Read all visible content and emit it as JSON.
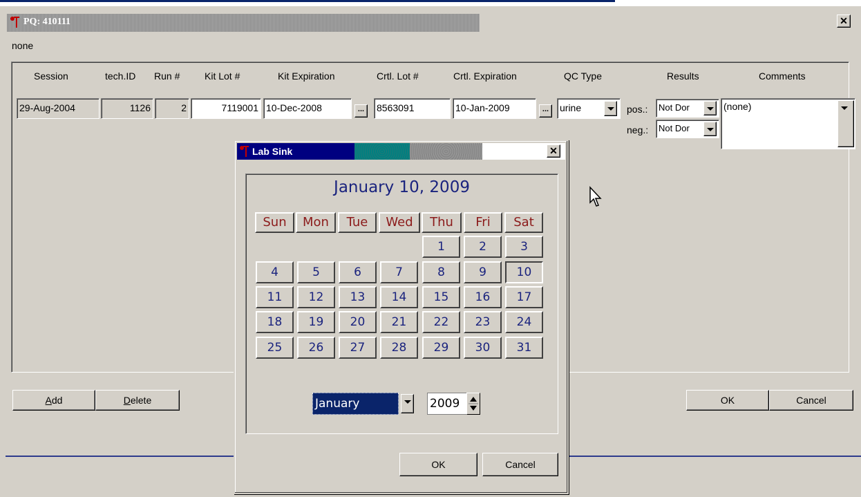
{
  "window": {
    "title": "PQ: 410111",
    "subtitle": "none"
  },
  "grid": {
    "headers": [
      "Session",
      "tech.ID",
      "Run #",
      "Kit Lot #",
      "Kit Expiration",
      "Crtl. Lot #",
      "Crtl. Expiration",
      "QC Type",
      "Results",
      "Comments"
    ],
    "row": {
      "session": "29-Aug-2004",
      "tech_id": "1126",
      "run": "2",
      "kit_lot": "7119001",
      "kit_expiration": "10-Dec-2008",
      "ctrl_lot": "8563091",
      "ctrl_expiration": "10-Jan-2009",
      "qc_type": "urine",
      "pos_label": "pos.:",
      "pos_value": "Not Dor",
      "neg_label": "neg.:",
      "neg_value": "Not Dor",
      "comments": "(none)",
      "dots": "..."
    }
  },
  "buttons": {
    "add": "Add",
    "add_u": "A",
    "add_rest": "dd",
    "delete_u": "D",
    "delete_rest": "elete",
    "ok": "OK",
    "cancel": "Cancel"
  },
  "dialog": {
    "title": "Lab Sink",
    "heading": "January 10, 2009",
    "day_headers": [
      "Sun",
      "Mon",
      "Tue",
      "Wed",
      "Thu",
      "Fri",
      "Sat"
    ],
    "days": [
      "1",
      "2",
      "3",
      "4",
      "5",
      "6",
      "7",
      "8",
      "9",
      "10",
      "11",
      "12",
      "13",
      "14",
      "15",
      "16",
      "17",
      "18",
      "19",
      "20",
      "21",
      "22",
      "23",
      "24",
      "25",
      "26",
      "27",
      "28",
      "29",
      "30",
      "31"
    ],
    "selected_day": "10",
    "month": "January",
    "year": "2009",
    "ok": "OK",
    "cancel": "Cancel"
  },
  "colors": {
    "titlebar_active": "#000080",
    "calendar_text": "#1a237e",
    "day_header_text": "#8b1a1a"
  }
}
